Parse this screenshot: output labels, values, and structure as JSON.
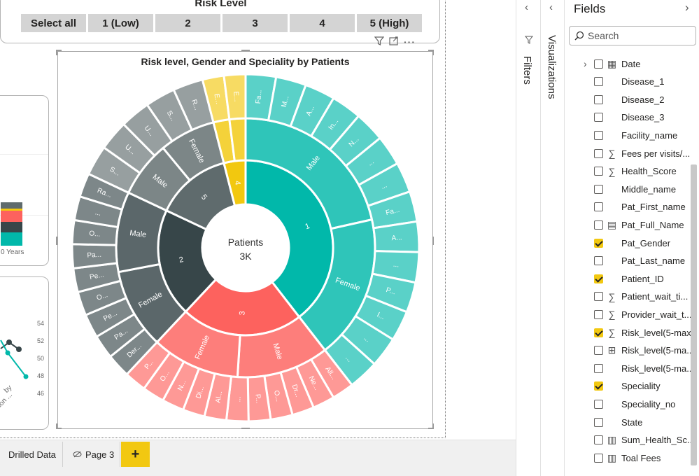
{
  "slicer": {
    "title": "Risk Level",
    "buttons": [
      "Select all",
      "1 (Low)",
      "2",
      "3",
      "4",
      "5 (High)"
    ]
  },
  "bg_chart": {
    "axis_label": "0 Years",
    "y_ticks": [
      "54",
      "52",
      "50",
      "48",
      "46"
    ],
    "x_label_1": "by",
    "x_label_2": "ation ..."
  },
  "visual": {
    "title": "Risk level, Gender and Speciality by Patients",
    "center_label": "Patients",
    "center_value": "3K"
  },
  "chart_data": {
    "type": "sunburst",
    "title": "Risk level, Gender and Speciality by Patients",
    "measure": "Patients",
    "total": "3K",
    "levels": [
      "Risk level",
      "Gender",
      "Speciality"
    ],
    "colors": {
      "1": "#01b8aa",
      "2": "#374649",
      "3": "#fd625e",
      "4": "#f2c80f",
      "5": "#5f6b6d"
    },
    "rings": {
      "risk": [
        {
          "label": "1",
          "share": 0.395
        },
        {
          "label": "3",
          "share": 0.225
        },
        {
          "label": "2",
          "share": 0.2
        },
        {
          "label": "5",
          "share": 0.14
        },
        {
          "label": "4",
          "share": 0.04
        }
      ],
      "gender": [
        {
          "risk": "1",
          "label": "Male",
          "share": 0.215
        },
        {
          "risk": "1",
          "label": "Female",
          "share": 0.18
        },
        {
          "risk": "3",
          "label": "Male",
          "share": 0.115
        },
        {
          "risk": "3",
          "label": "Female",
          "share": 0.11
        },
        {
          "risk": "2",
          "label": "Female",
          "share": 0.1
        },
        {
          "risk": "2",
          "label": "Male",
          "share": 0.1
        },
        {
          "risk": "5",
          "label": "Male",
          "share": 0.07
        },
        {
          "risk": "5",
          "label": "Female",
          "share": 0.07
        },
        {
          "risk": "4",
          "label": "",
          "share": 0.02
        },
        {
          "risk": "4",
          "label": "",
          "share": 0.02
        }
      ],
      "speciality": [
        {
          "risk": "1",
          "labels": [
            "Fa...",
            "M...",
            "A...",
            "In...",
            "N...",
            "...",
            "...",
            "Fa...",
            "A...",
            "...",
            "P...",
            "I...",
            "...",
            "..."
          ]
        },
        {
          "risk": "3",
          "labels": [
            "All...",
            "Ne...",
            "Dr...",
            "O...",
            "P...",
            "...",
            "Al...",
            "Di...",
            "N...",
            "O...",
            "P..."
          ]
        },
        {
          "risk": "2",
          "labels": [
            "Der...",
            "Pa...",
            "Pe...",
            "O...",
            "Pe...",
            "Pa...",
            "O...",
            "...",
            "Ra..."
          ]
        },
        {
          "risk": "5",
          "labels": [
            "S...",
            "U...",
            "U...",
            "S...",
            "R..."
          ]
        },
        {
          "risk": "4",
          "labels": [
            "E...",
            "E..."
          ]
        }
      ]
    }
  },
  "visual_header": {
    "filter_icon": "filter-icon",
    "focus_icon": "focus-mode-icon",
    "more_icon": "more-options-icon"
  },
  "tabs": [
    {
      "label": "Drilled Data"
    },
    {
      "label": "Page 3"
    }
  ],
  "panes": {
    "filters_label": "Filters",
    "visualizations_label": "Visualizations",
    "fields_title": "Fields",
    "search_placeholder": "Search"
  },
  "fields": [
    {
      "label": "Date",
      "checked": false,
      "icon": "calendar-icon",
      "expand": true
    },
    {
      "label": "Disease_1",
      "checked": false,
      "icon": ""
    },
    {
      "label": "Disease_2",
      "checked": false,
      "icon": ""
    },
    {
      "label": "Disease_3",
      "checked": false,
      "icon": ""
    },
    {
      "label": "Facility_name",
      "checked": false,
      "icon": ""
    },
    {
      "label": "Fees per visits/...",
      "checked": false,
      "icon": "sigma-icon"
    },
    {
      "label": "Health_Score",
      "checked": false,
      "icon": "sigma-icon"
    },
    {
      "label": "Middle_name",
      "checked": false,
      "icon": ""
    },
    {
      "label": "Pat_First_name",
      "checked": false,
      "icon": ""
    },
    {
      "label": "Pat_Full_Name",
      "checked": false,
      "icon": "calculated-column-icon"
    },
    {
      "label": "Pat_Gender",
      "checked": true,
      "icon": ""
    },
    {
      "label": "Pat_Last_name",
      "checked": false,
      "icon": ""
    },
    {
      "label": "Patient_ID",
      "checked": true,
      "icon": ""
    },
    {
      "label": "Patient_wait_ti...",
      "checked": false,
      "icon": "sigma-icon"
    },
    {
      "label": "Provider_wait_t...",
      "checked": false,
      "icon": "sigma-icon"
    },
    {
      "label": "Risk_level(5-max)",
      "checked": true,
      "icon": "sigma-icon"
    },
    {
      "label": "Risk_level(5-ma...",
      "checked": false,
      "icon": "table-icon"
    },
    {
      "label": "Risk_level(5-ma...",
      "checked": false,
      "icon": ""
    },
    {
      "label": "Speciality",
      "checked": true,
      "icon": ""
    },
    {
      "label": "Speciality_no",
      "checked": false,
      "icon": ""
    },
    {
      "label": "State",
      "checked": false,
      "icon": ""
    },
    {
      "label": "Sum_Health_Sc...",
      "checked": false,
      "icon": "calculator-icon"
    },
    {
      "label": "Toal Fees",
      "checked": false,
      "icon": "calculator-icon"
    }
  ]
}
